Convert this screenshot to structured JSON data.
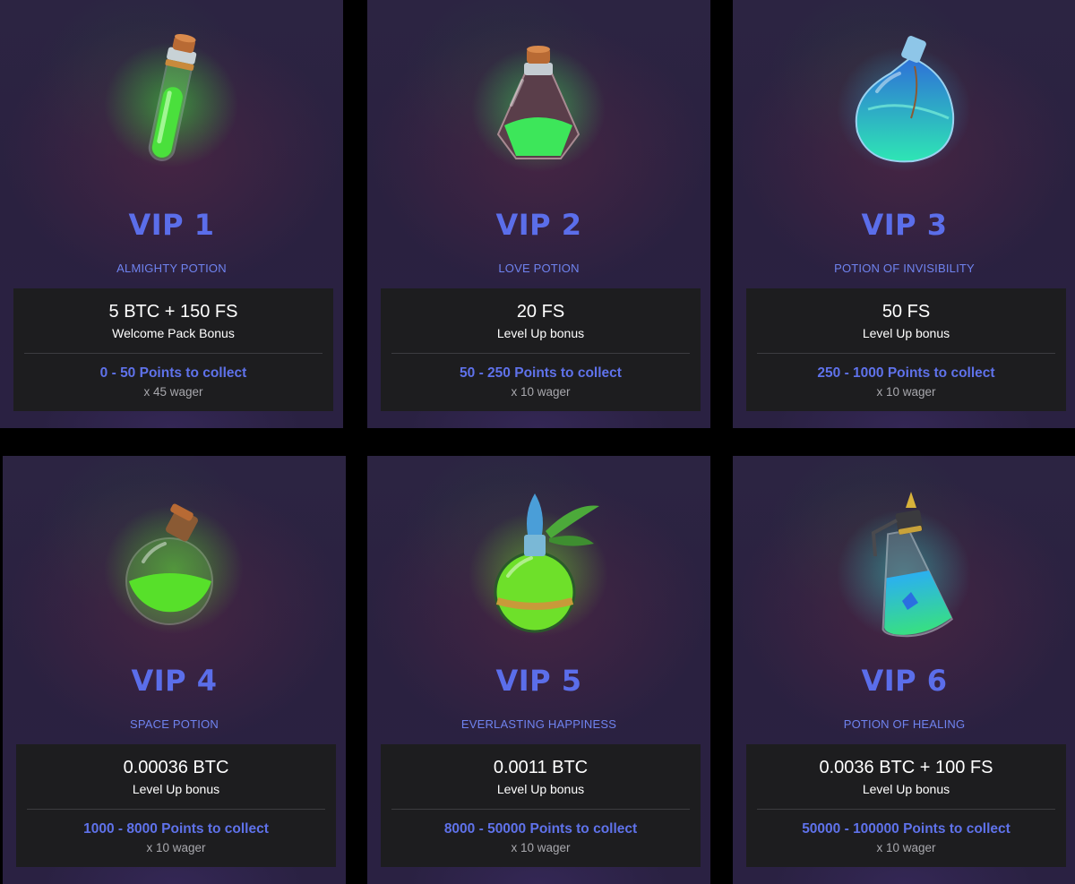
{
  "cards": [
    {
      "title": "VIP 1",
      "potion": "ALMIGHTY POTION",
      "bonus_value": "5 BTC + 150 FS",
      "bonus_label": "Welcome Pack Bonus",
      "points": "0 - 50 Points to collect",
      "wager": "x 45 wager",
      "liquid_color": "#3ee03a",
      "icon": "tube-potion-icon"
    },
    {
      "title": "VIP 2",
      "potion": "LOVE POTION",
      "bonus_value": "20 FS",
      "bonus_label": "Level Up bonus",
      "points": "50 - 250 Points to collect",
      "wager": "x 10 wager",
      "liquid_color": "#3de65a",
      "icon": "flask-potion-icon"
    },
    {
      "title": "VIP 3",
      "potion": "POTION OF INVISIBILITY",
      "bonus_value": "50 FS",
      "bonus_label": "Level Up bonus",
      "points": "250 - 1000 Points to collect",
      "wager": "x 10 wager",
      "liquid_color": "#2bb4e8",
      "icon": "round-bottle-potion-icon"
    },
    {
      "title": "VIP 4",
      "potion": "SPACE POTION",
      "bonus_value": "0.00036 BTC",
      "bonus_label": "Level Up bonus",
      "points": "1000 - 8000 Points to collect",
      "wager": "x 10 wager",
      "liquid_color": "#57e02a",
      "icon": "sphere-potion-icon"
    },
    {
      "title": "VIP 5",
      "potion": "EVERLASTING HAPPINESS",
      "bonus_value": "0.0011 BTC",
      "bonus_label": "Level Up bonus",
      "points": "8000 - 50000 Points to collect",
      "wager": "x 10 wager",
      "liquid_color": "#6ee02a",
      "icon": "leaf-flask-potion-icon"
    },
    {
      "title": "VIP 6",
      "potion": "POTION OF HEALING",
      "bonus_value": "0.0036 BTC + 100 FS",
      "bonus_label": "Level Up bonus",
      "points": "50000 - 100000 Points to collect",
      "wager": "x 10 wager",
      "liquid_color": "#32d0c8",
      "icon": "cone-flask-potion-icon"
    }
  ]
}
